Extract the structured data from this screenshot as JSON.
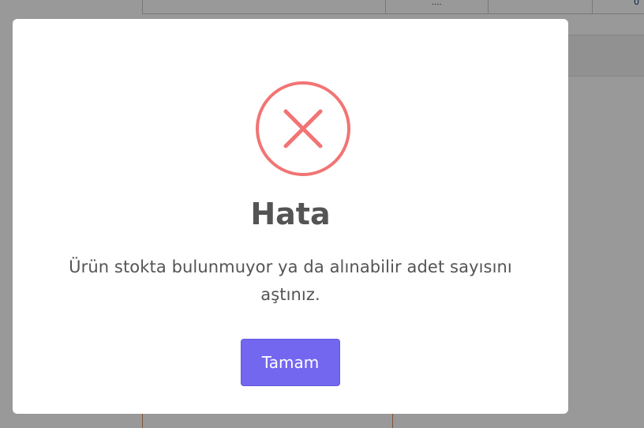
{
  "background": {
    "table_header_cells": [
      "",
      "....",
      "",
      ""
    ],
    "corner_glyph": "0"
  },
  "dialog": {
    "icon": "error-x-icon",
    "icon_color": "#f27474",
    "title": "Hata",
    "message": "Ürün stokta bulunmuyor ya da alınabilir adet sayısını aştınız.",
    "confirm_label": "Tamam",
    "confirm_color": "#7367f0"
  }
}
